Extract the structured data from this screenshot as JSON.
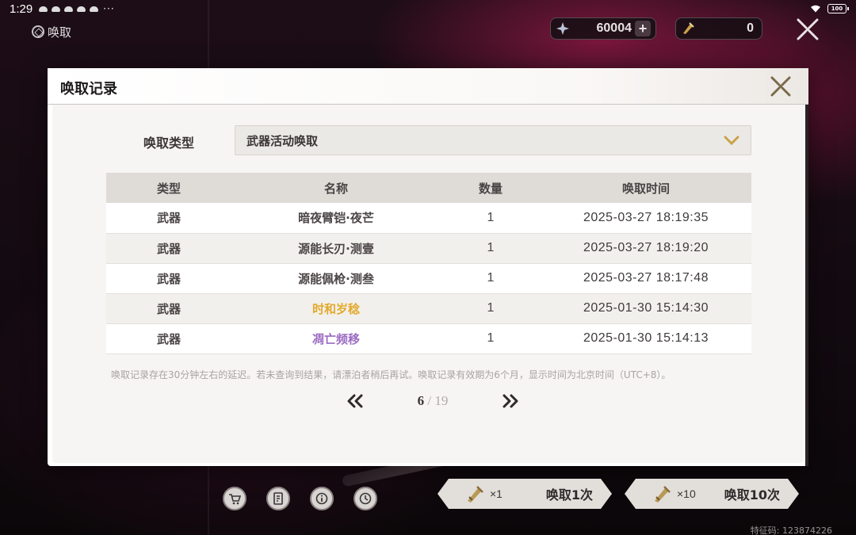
{
  "status_bar": {
    "time": "1:29",
    "dots": "···",
    "battery": "100"
  },
  "header": {
    "title": "唤取",
    "currency_primary": "60004",
    "currency_primary_plus": "+",
    "currency_secondary": "0"
  },
  "dialog": {
    "title": "唤取记录",
    "type_label": "唤取类型",
    "type_selected": "武器活动唤取",
    "columns": [
      "类型",
      "名称",
      "数量",
      "唤取时间"
    ],
    "rows": [
      {
        "type": "武器",
        "name": "暗夜臂铠·夜芒",
        "qty": "1",
        "time": "2025-03-27 18:19:35",
        "rarity_color": "#4b4546"
      },
      {
        "type": "武器",
        "name": "源能长刃·测壹",
        "qty": "1",
        "time": "2025-03-27 18:19:20",
        "rarity_color": "#4b4546"
      },
      {
        "type": "武器",
        "name": "源能佩枪·测叁",
        "qty": "1",
        "time": "2025-03-27 18:17:48",
        "rarity_color": "#4b4546"
      },
      {
        "type": "武器",
        "name": "时和岁稔",
        "qty": "1",
        "time": "2025-01-30 15:14:30",
        "rarity_color": "#e2a92a"
      },
      {
        "type": "武器",
        "name": "凋亡频移",
        "qty": "1",
        "time": "2025-01-30 15:14:13",
        "rarity_color": "#9b6bc2"
      }
    ],
    "notice": "唤取记录存在30分钟左右的延迟。若未查询到结果，请漂泊者稍后再试。唤取记录有效期为6个月，显示时间为北京时间（UTC+8）。",
    "pager": {
      "current": "6",
      "separator": " / ",
      "total": "19"
    }
  },
  "bottom": {
    "icons": [
      "shop-icon",
      "details-icon",
      "info-icon",
      "history-icon"
    ],
    "pull_one": {
      "mult": "×1",
      "label": "唤取1次"
    },
    "pull_ten": {
      "mult": "×10",
      "label": "唤取10次"
    },
    "feature_code": "特征码: 123874226"
  },
  "colors": {
    "gold": "#e2a92a",
    "purple": "#9b6bc2",
    "accent": "#8a6d3b"
  }
}
